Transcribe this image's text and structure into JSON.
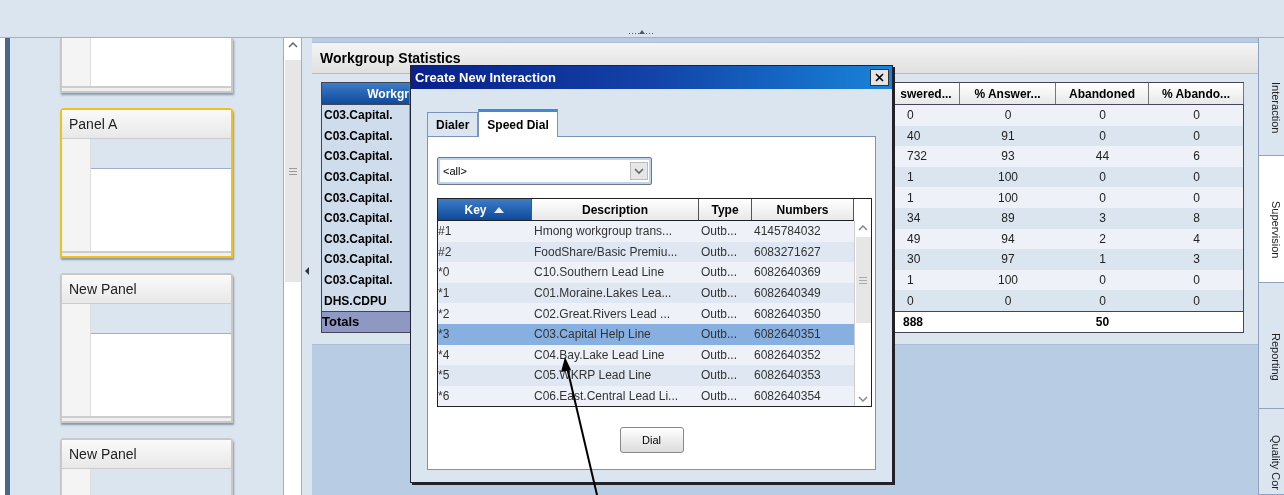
{
  "panels": [
    {
      "selected": false
    },
    {
      "title": "Panel A",
      "selected": true
    },
    {
      "title": "New Panel",
      "selected": false
    },
    {
      "title": "New Panel",
      "selected": false
    }
  ],
  "statistics": {
    "title": "Workgroup Statistics",
    "columns": [
      {
        "label": "Workgr",
        "sorted": true
      },
      {
        "label": "swered...",
        "sorted": false
      },
      {
        "label": "% Answer...",
        "sorted": false
      },
      {
        "label": "Abandoned",
        "sorted": false
      },
      {
        "label": "% Abando...",
        "sorted": false
      }
    ],
    "rows": [
      [
        "C03.Capital.",
        "0",
        "0",
        "0",
        "0"
      ],
      [
        "C03.Capital.",
        "40",
        "91",
        "0",
        "0"
      ],
      [
        "C03.Capital.",
        "732",
        "93",
        "44",
        "6"
      ],
      [
        "C03.Capital.",
        "1",
        "100",
        "0",
        "0"
      ],
      [
        "C03.Capital.",
        "1",
        "100",
        "0",
        "0"
      ],
      [
        "C03.Capital.",
        "34",
        "89",
        "3",
        "8"
      ],
      [
        "C03.Capital.",
        "49",
        "94",
        "2",
        "4"
      ],
      [
        "C03.Capital.",
        "30",
        "97",
        "1",
        "3"
      ],
      [
        "C03.Capital.",
        "1",
        "100",
        "0",
        "0"
      ],
      [
        "DHS.CDPU",
        "0",
        "0",
        "0",
        "0"
      ]
    ],
    "totals": {
      "label": "Totals",
      "answered": "888",
      "abandoned": "50"
    }
  },
  "dialog": {
    "title": "Create New Interaction",
    "tabs": [
      {
        "label": "Dialer",
        "selected": false
      },
      {
        "label": "Speed Dial",
        "selected": true
      }
    ],
    "filter": {
      "value": "<all>"
    },
    "columns": [
      {
        "label": "Key",
        "sorted": true
      },
      {
        "label": "Description",
        "sorted": false
      },
      {
        "label": "Type",
        "sorted": false
      },
      {
        "label": "Numbers",
        "sorted": false
      }
    ],
    "rows": [
      {
        "cells": [
          "#1",
          "Hmong workgroup trans...",
          "Outb...",
          "4145784032"
        ],
        "selected": false
      },
      {
        "cells": [
          "#2",
          "FoodShare/Basic Premiu...",
          "Outb...",
          "6083271627"
        ],
        "selected": false
      },
      {
        "cells": [
          "*0",
          "C10.Southern Lead Line",
          "Outb...",
          "6082640369"
        ],
        "selected": false
      },
      {
        "cells": [
          "*1",
          "C01.Moraine.Lakes Lea...",
          "Outb...",
          "6082640349"
        ],
        "selected": false
      },
      {
        "cells": [
          "*2",
          "C02.Great.Rivers Lead ...",
          "Outb...",
          "6082640350"
        ],
        "selected": false
      },
      {
        "cells": [
          "*3",
          "C03.Capital Help Line",
          "Outb...",
          "6082640351"
        ],
        "selected": true
      },
      {
        "cells": [
          "*4",
          "C04.Bay.Lake Lead Line",
          "Outb...",
          "6082640352"
        ],
        "selected": false
      },
      {
        "cells": [
          "*5",
          "C05.WKRP Lead Line",
          "Outb...",
          "6082640353"
        ],
        "selected": false
      },
      {
        "cells": [
          "*6",
          "C06.East.Central Lead Li...",
          "Outb...",
          "6082640354"
        ],
        "selected": false
      }
    ],
    "button": "Dial"
  },
  "side_tabs": [
    {
      "label": "Interaction",
      "selected": false
    },
    {
      "label": "Supervision",
      "selected": true
    },
    {
      "label": "Reporting",
      "selected": false
    },
    {
      "label": "Quality Cor",
      "selected": false
    }
  ]
}
